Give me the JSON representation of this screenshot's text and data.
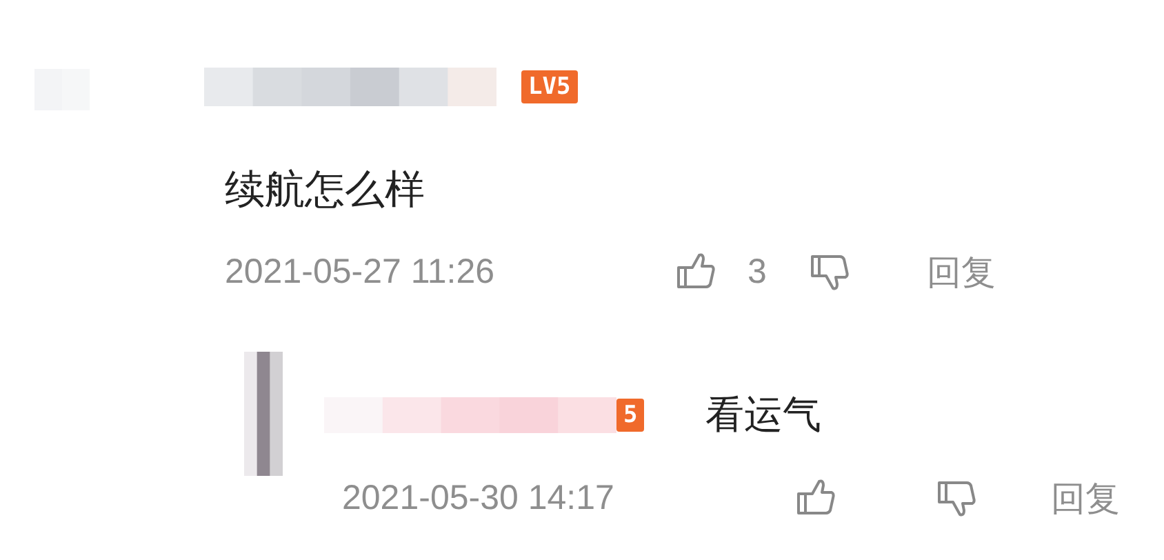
{
  "comments": [
    {
      "user_level": "LV5",
      "content": "续航怎么样",
      "time": "2021-05-27 11:26",
      "likes": "3",
      "reply_label": "回复",
      "replies": [
        {
          "user_level": "5",
          "content": "看运气",
          "time": "2021-05-30 14:17",
          "reply_label": "回复"
        }
      ]
    }
  ]
}
